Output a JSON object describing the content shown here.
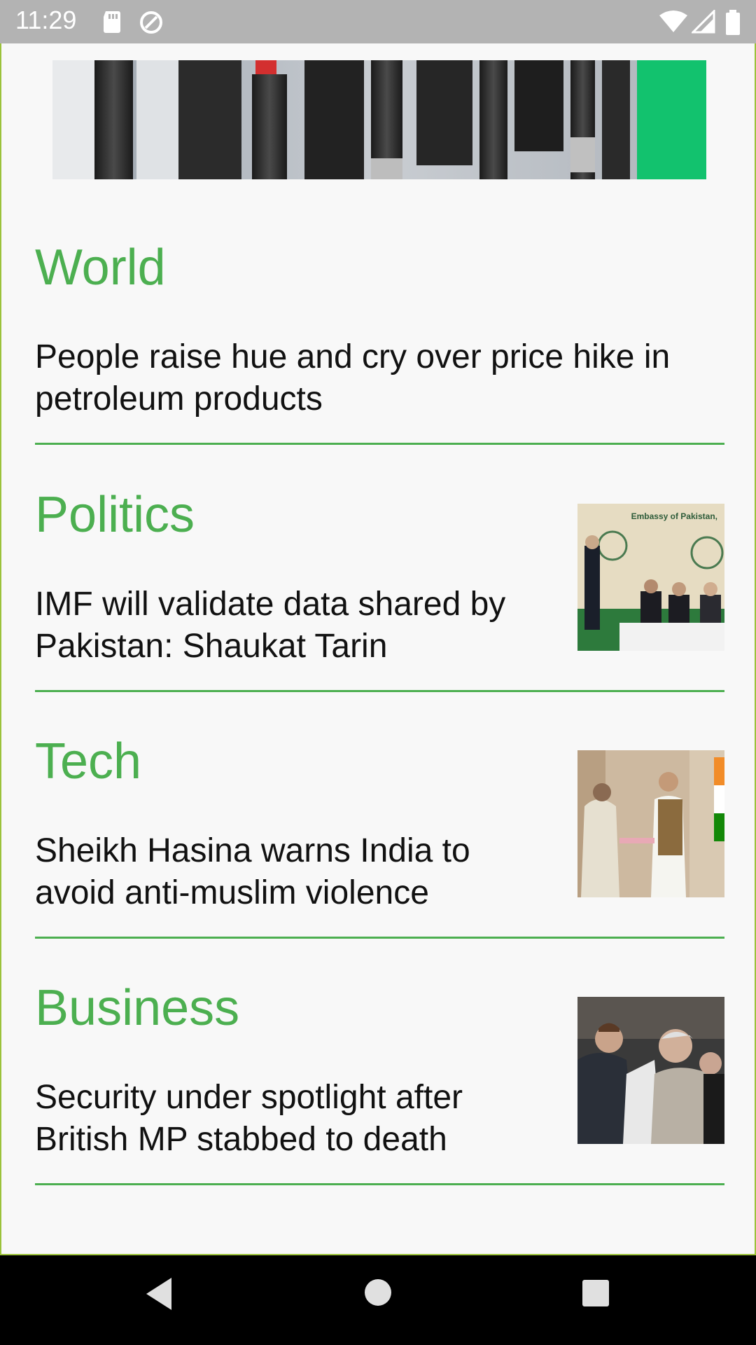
{
  "status_bar": {
    "time": "11:29",
    "icons": [
      "sd-card-icon",
      "sync-icon",
      "wifi-icon",
      "signal-icon",
      "battery-icon"
    ]
  },
  "hero": {
    "image": "fuel-nozzles-photo"
  },
  "sections": [
    {
      "title": "World",
      "headline": "People raise hue and cry over price hike in petroleum products",
      "has_thumbnail": false
    },
    {
      "title": "Politics",
      "headline": "IMF will validate data shared by Pakistan: Shaukat Tarin",
      "thumbnail": "embassy-event-photo",
      "thumb_text": "Embassy of Pakistan,"
    },
    {
      "title": "Tech",
      "headline": "Sheikh Hasina warns India to avoid anti-muslim violence",
      "thumbnail": "leaders-handshake-photo"
    },
    {
      "title": "Business",
      "headline": "Security under spotlight after British MP stabbed to death",
      "thumbnail": "mourners-photo"
    }
  ],
  "nav_bar": {
    "buttons": [
      "back-icon",
      "home-icon",
      "recents-icon"
    ]
  },
  "colors": {
    "accent": "#4caf50",
    "status_bar": "#b3b3b3",
    "frame_border": "#9bc23a",
    "background": "#f8f8f8"
  }
}
